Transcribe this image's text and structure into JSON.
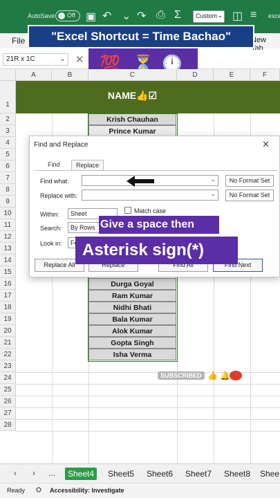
{
  "titlebar": {
    "autosave_label": "AutoSave",
    "autosave_state": "Off",
    "view_select": "Custom",
    "filename_partial": "exce",
    "accent_color": "#1f7a44"
  },
  "ribbon": {
    "file_tab": "File",
    "new_tab_partial": "New Tab"
  },
  "banner": {
    "text": "\"Excel Shortcut = Time Bachao\"",
    "color": "#1b3f86"
  },
  "formula_bar": {
    "namebox_value": "21R x 1C",
    "cancel_glyph": "✕"
  },
  "emojis": [
    "💯",
    "⏳",
    "🕛"
  ],
  "columns": [
    "A",
    "B",
    "C",
    "D",
    "E",
    "F"
  ],
  "rows": [
    "1",
    "2",
    "3",
    "4",
    "5",
    "6",
    "7",
    "8",
    "9",
    "10",
    "11",
    "12",
    "13",
    "14",
    "15",
    "16",
    "17",
    "18",
    "19",
    "20",
    "21",
    "22",
    "23",
    "24",
    "25",
    "26",
    "27",
    "28"
  ],
  "sheet": {
    "header": "NAME👍☑",
    "names_top": [
      "Krish Chauhan",
      "Prince Kumar"
    ],
    "names_bottom": [
      "Durga Goyal",
      "Ram Kumar",
      "Nidhi Bhati",
      "Bala Kumar",
      "Alok Kumar",
      "Gopta Singh",
      "Isha Verma"
    ]
  },
  "dialog": {
    "title": "Find and Replace",
    "tabs": [
      "Find",
      "Replace"
    ],
    "active_tab": "Replace",
    "find_label": "Find what:",
    "find_value": "",
    "replace_label": "Replace with:",
    "replace_value": "",
    "no_format_1": "No Format Set",
    "no_format_2": "No Format Set",
    "within_label": "Within:",
    "within_value": "Sheet",
    "match_case_label": "Match case",
    "search_label": "Search:",
    "search_value": "By Rows",
    "lookin_label": "Look in:",
    "lookin_value": "Fo",
    "replace_all_btn": "Replace All",
    "replace_btn": "Replace",
    "find_all_btn": "Find All",
    "find_next_btn": "Find Next"
  },
  "overlay": {
    "line1": "Give a space then",
    "line2": "Asterisk sign(*)",
    "color": "#5b2ea6"
  },
  "subscribed_badge": "SUBSCRIBED",
  "sheet_tabs": {
    "more": "...",
    "tabs": [
      "Sheet4",
      "Sheet5",
      "Sheet6",
      "Sheet7",
      "Sheet8",
      "Shee"
    ],
    "active": "Sheet4"
  },
  "status": {
    "ready": "Ready",
    "accessibility": "Accessibility: Investigate"
  }
}
